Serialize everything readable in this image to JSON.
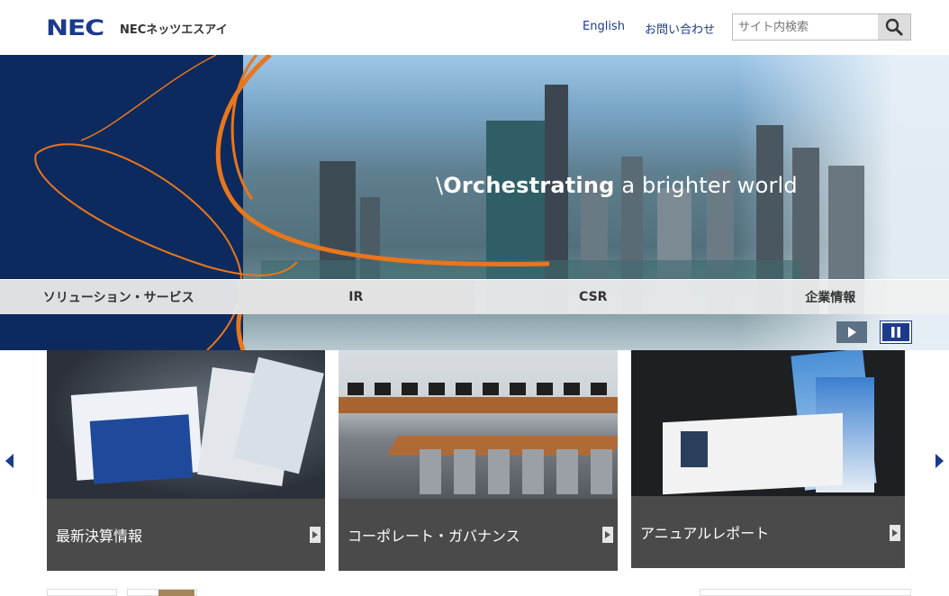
{
  "header": {
    "logo_mark": "NEC",
    "company_name": "NECネッツエスアイ",
    "english_link": "English",
    "contact_link": "お問い合わせ",
    "search_placeholder": "サイト内検索"
  },
  "hero": {
    "tagline_bold": "Orchestrating",
    "tagline_rest": " a brighter world"
  },
  "nav": {
    "items": [
      {
        "label": "ソリューション・サービス"
      },
      {
        "label": "IR"
      },
      {
        "label": "CSR"
      },
      {
        "label": "企業情報"
      }
    ]
  },
  "cards": [
    {
      "label": "最新決算情報"
    },
    {
      "label": "コーポレート・ガバナンス"
    },
    {
      "label": "アニュアルレポート"
    }
  ],
  "colors": {
    "brand": "#1b3a8c",
    "hero_navy": "#0d2a5e",
    "swirl_orange": "#e8761c",
    "card_bg": "#4a4a4a"
  }
}
